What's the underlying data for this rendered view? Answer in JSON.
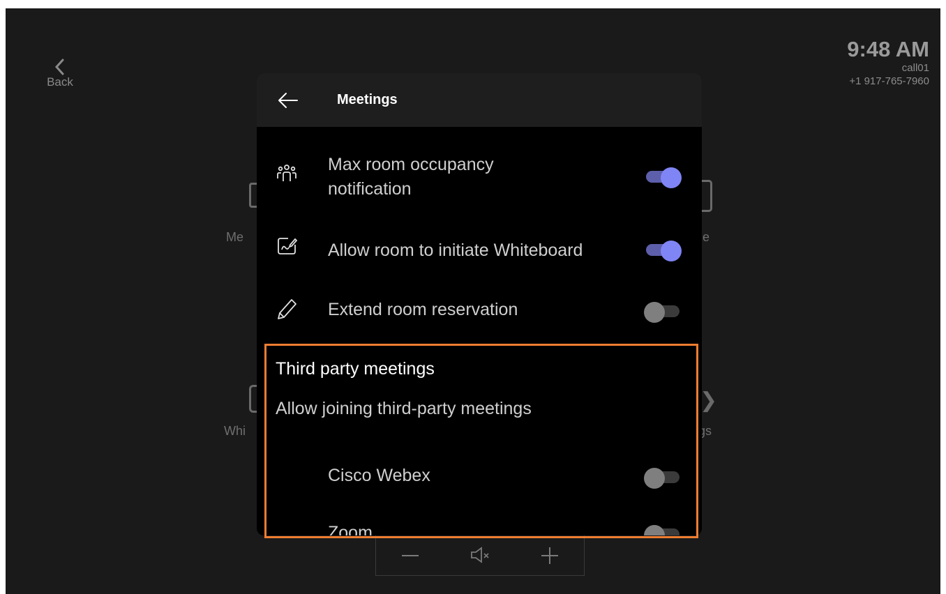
{
  "status": {
    "time": "9:48 AM",
    "room_name": "call01",
    "phone": "+1 917-765-7960"
  },
  "background": {
    "back_label": "Back",
    "tiles": [
      "Me",
      "e",
      "Whi",
      "gs"
    ]
  },
  "dialog": {
    "title": "Meetings",
    "settings": [
      {
        "icon": "people-icon",
        "label": "Max room occupancy notification",
        "label_line1": "Max room occupancy",
        "label_line2": "notification",
        "enabled": true
      },
      {
        "icon": "whiteboard-icon",
        "label": "Allow room to initiate Whiteboard",
        "enabled": true
      },
      {
        "icon": "pencil-icon",
        "label": "Extend room reservation",
        "enabled": false
      }
    ],
    "third_party": {
      "title": "Third party meetings",
      "subtitle": "Allow joining third-party meetings",
      "options": [
        {
          "label": "Cisco Webex",
          "enabled": false
        },
        {
          "label": "Zoom",
          "enabled": false
        }
      ]
    }
  },
  "colors": {
    "toggle_on": "#7f85f5",
    "highlight": "#ee7d31"
  }
}
